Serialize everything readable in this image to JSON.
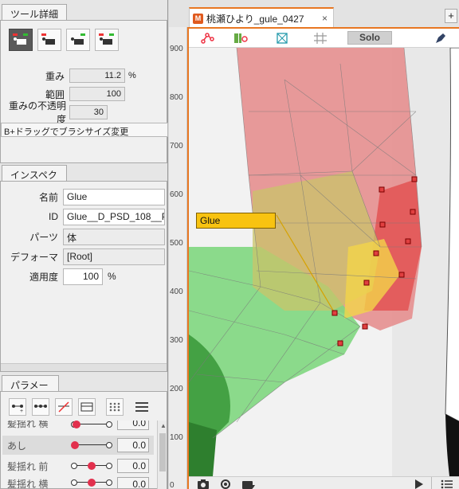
{
  "tool_detail": {
    "tab_label": "ツール詳細",
    "weight_label": "重み",
    "weight_value": "11.2",
    "weight_unit": "%",
    "range_label": "範囲",
    "range_value": "100",
    "opacity_label": "重みの不透明度",
    "opacity_value": "30",
    "hint": "B+ドラッグでブラシサイズ変更"
  },
  "inspector": {
    "tab_label": "インスペクタ",
    "name_label": "名前",
    "name_value": "Glue",
    "id_label": "ID",
    "id_value": "Glue__D_PSD_108__P",
    "parts_label": "パーツ",
    "parts_value": "体",
    "deformer_label": "デフォーマ",
    "deformer_value": "[Root]",
    "apply_label": "適用度",
    "apply_value": "100",
    "apply_unit": "%"
  },
  "parameters": {
    "tab_label": "パラメータ",
    "rows": [
      {
        "name": "髪揺れ 横",
        "value": "0.0",
        "knob": 0.0
      },
      {
        "name": "あし",
        "value": "0.0",
        "knob": 0.0
      },
      {
        "name": "髪揺れ 前",
        "value": "0.0",
        "knob": 0.5
      },
      {
        "name": "髪揺れ 横",
        "value": "0.0",
        "knob": 0.5
      }
    ]
  },
  "document": {
    "tab_title": "桃瀬ひより_gule_0427",
    "close": "×",
    "add": "+",
    "solo_label": "Solo",
    "glue_label": "Glue"
  },
  "ruler": {
    "labels": [
      "900",
      "800",
      "700",
      "600",
      "500",
      "400",
      "300",
      "200",
      "100",
      "0"
    ]
  },
  "colors": {
    "accent": "#e87722",
    "glue_label": "#f8c311",
    "knob": "#e2304d"
  }
}
